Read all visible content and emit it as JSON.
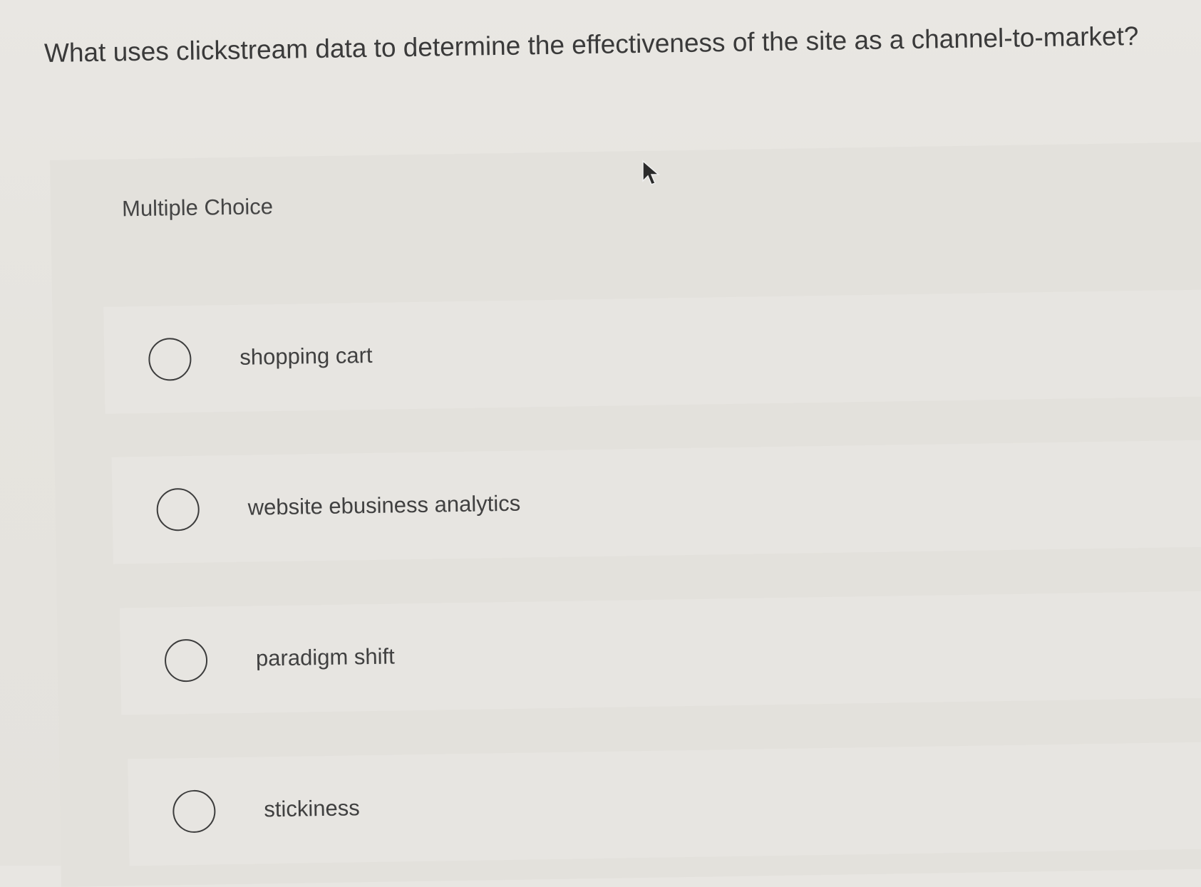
{
  "question": {
    "text": "What uses clickstream data to determine the effectiveness of the site as a channel-to-market?"
  },
  "panel": {
    "label": "Multiple Choice"
  },
  "options": [
    {
      "label": "shopping cart",
      "selected": false
    },
    {
      "label": "website ebusiness analytics",
      "selected": false
    },
    {
      "label": "paradigm shift",
      "selected": false
    },
    {
      "label": "stickiness",
      "selected": false
    }
  ],
  "icons": {
    "cursor": "mouse-pointer-icon",
    "radio": "radio-button-icon"
  },
  "colors": {
    "background": "#e8e6e2",
    "text": "#3a3a3a",
    "radio_border": "#3c3c3c"
  }
}
